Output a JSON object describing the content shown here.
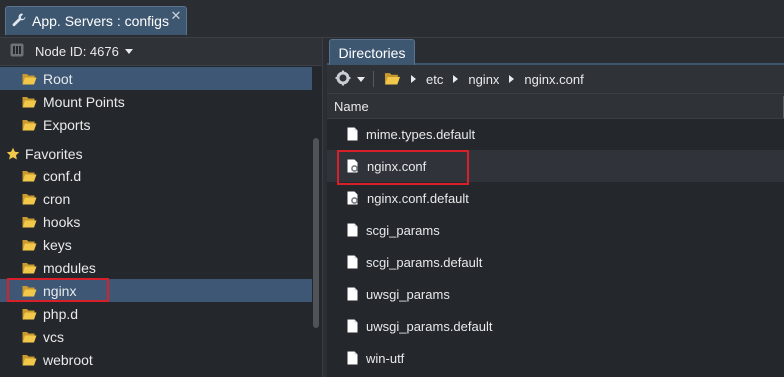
{
  "window_tab": {
    "title": "App. Servers : configs",
    "close_glyph": "✕"
  },
  "left_panel": {
    "node_label": "Node ID: 4676",
    "root_items": [
      {
        "label": "Root",
        "selected": true
      },
      {
        "label": "Mount Points",
        "selected": false
      },
      {
        "label": "Exports",
        "selected": false
      }
    ],
    "favorites_title": "Favorites",
    "favorites": [
      {
        "label": "conf.d"
      },
      {
        "label": "cron"
      },
      {
        "label": "hooks"
      },
      {
        "label": "keys"
      },
      {
        "label": "modules"
      },
      {
        "label": "nginx"
      },
      {
        "label": "php.d"
      },
      {
        "label": "vcs"
      },
      {
        "label": "webroot"
      }
    ]
  },
  "right_panel": {
    "tab_label": "Directories",
    "breadcrumb": [
      "etc",
      "nginx",
      "nginx.conf"
    ],
    "column_header": "Name",
    "files": [
      {
        "name": "mime.types.default",
        "icon": "file-icon"
      },
      {
        "name": "nginx.conf",
        "icon": "config-file-icon"
      },
      {
        "name": "nginx.conf.default",
        "icon": "config-file-icon"
      },
      {
        "name": "scgi_params",
        "icon": "file-icon"
      },
      {
        "name": "scgi_params.default",
        "icon": "file-icon"
      },
      {
        "name": "uwsgi_params",
        "icon": "file-icon"
      },
      {
        "name": "uwsgi_params.default",
        "icon": "file-icon"
      },
      {
        "name": "win-utf",
        "icon": "file-icon"
      }
    ]
  },
  "colors": {
    "accent_tab": "#3e5771",
    "selection": "#3d5775",
    "highlight_box": "#d7202a",
    "folder": "#f2c84b"
  }
}
